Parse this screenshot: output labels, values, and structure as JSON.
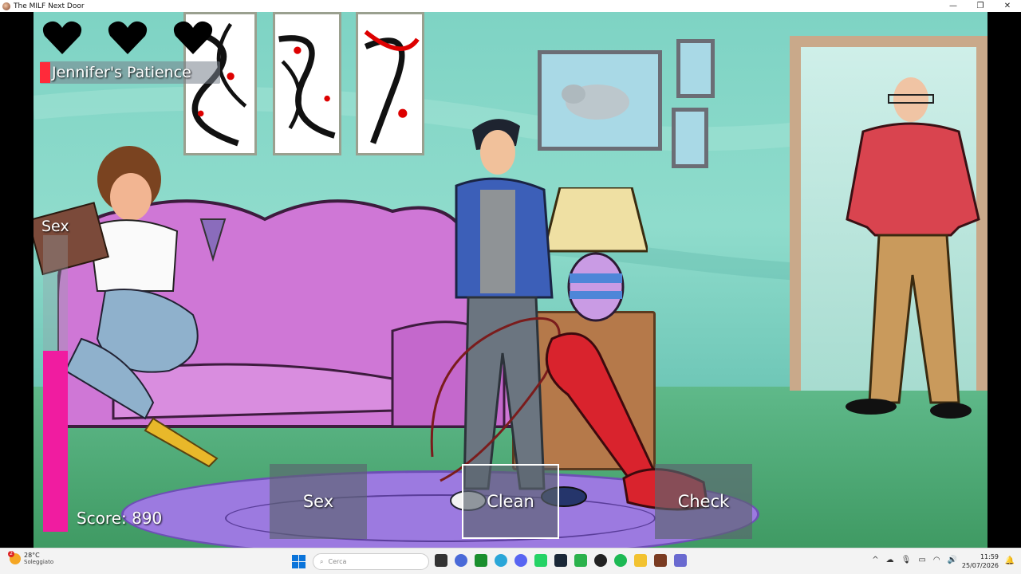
{
  "window": {
    "title": "The MILF Next Door",
    "minimize": "—",
    "maximize": "❐",
    "close": "✕"
  },
  "hud": {
    "lives": 3,
    "patience_label": "Jennifer's Patience",
    "meter_label": "Sex",
    "meter_level_percent": 61,
    "score_text": "Score: 890"
  },
  "actions": [
    {
      "label": "Sex",
      "selected": false
    },
    {
      "label": "Clean",
      "selected": true
    },
    {
      "label": "Check",
      "selected": false
    }
  ],
  "taskbar": {
    "weather_temp": "28°C",
    "weather_cond": "Soleggiato",
    "weather_badge": "2",
    "search_placeholder": "Cerca",
    "time": "11:59",
    "date": "25/07/2026",
    "app_icons": [
      "file-explorer-icon",
      "app-icon-blue",
      "xbox-icon",
      "edge-icon",
      "discord-icon",
      "whatsapp-icon",
      "steam-icon",
      "app-icon-green",
      "app-icon-dark",
      "spotify-icon",
      "folder-icon",
      "game-icon",
      "snipping-icon"
    ]
  },
  "colors": {
    "patience_bar": "#ff2a3a",
    "meter_fill": "#f01ca0"
  }
}
